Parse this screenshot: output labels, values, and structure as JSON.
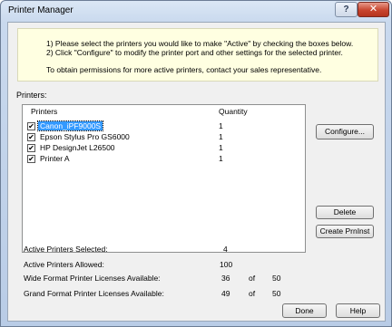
{
  "window": {
    "title": "Printer Manager",
    "help_glyph": "?",
    "close_glyph": "✕"
  },
  "info": {
    "line1": "1) Please select the printers you would like to make \"Active\" by checking the boxes below.",
    "line2": "2) Click \"Configure\" to modify the printer port and other settings for the selected printer.",
    "line3": "To obtain permissions for more active printers, contact your sales representative."
  },
  "printers_label": "Printers:",
  "list": {
    "headers": {
      "name": "Printers",
      "quantity": "Quantity"
    },
    "rows": [
      {
        "name": "Canon_iPF9000S",
        "quantity": "1",
        "checked": true,
        "selected": true
      },
      {
        "name": "Epson Stylus Pro GS6000",
        "quantity": "1",
        "checked": true,
        "selected": false
      },
      {
        "name": "HP DesignJet L26500",
        "quantity": "1",
        "checked": true,
        "selected": false
      },
      {
        "name": "Printer A",
        "quantity": "1",
        "checked": true,
        "selected": false
      }
    ],
    "check_glyph": "✔"
  },
  "buttons": {
    "configure": "Configure...",
    "delete": "Delete",
    "create": "Create PrnInst",
    "done": "Done",
    "help": "Help"
  },
  "stats": {
    "active_selected_label": "Active Printers Selected:",
    "active_selected_value": "4",
    "active_allowed_label": "Active Printers Allowed:",
    "active_allowed_value": "100",
    "wide_label": "Wide Format Printer Licenses Available:",
    "wide_value": "36",
    "wide_of": "of",
    "wide_total": "50",
    "grand_label": "Grand Format Printer Licenses Available:",
    "grand_value": "49",
    "grand_of": "of",
    "grand_total": "50"
  }
}
